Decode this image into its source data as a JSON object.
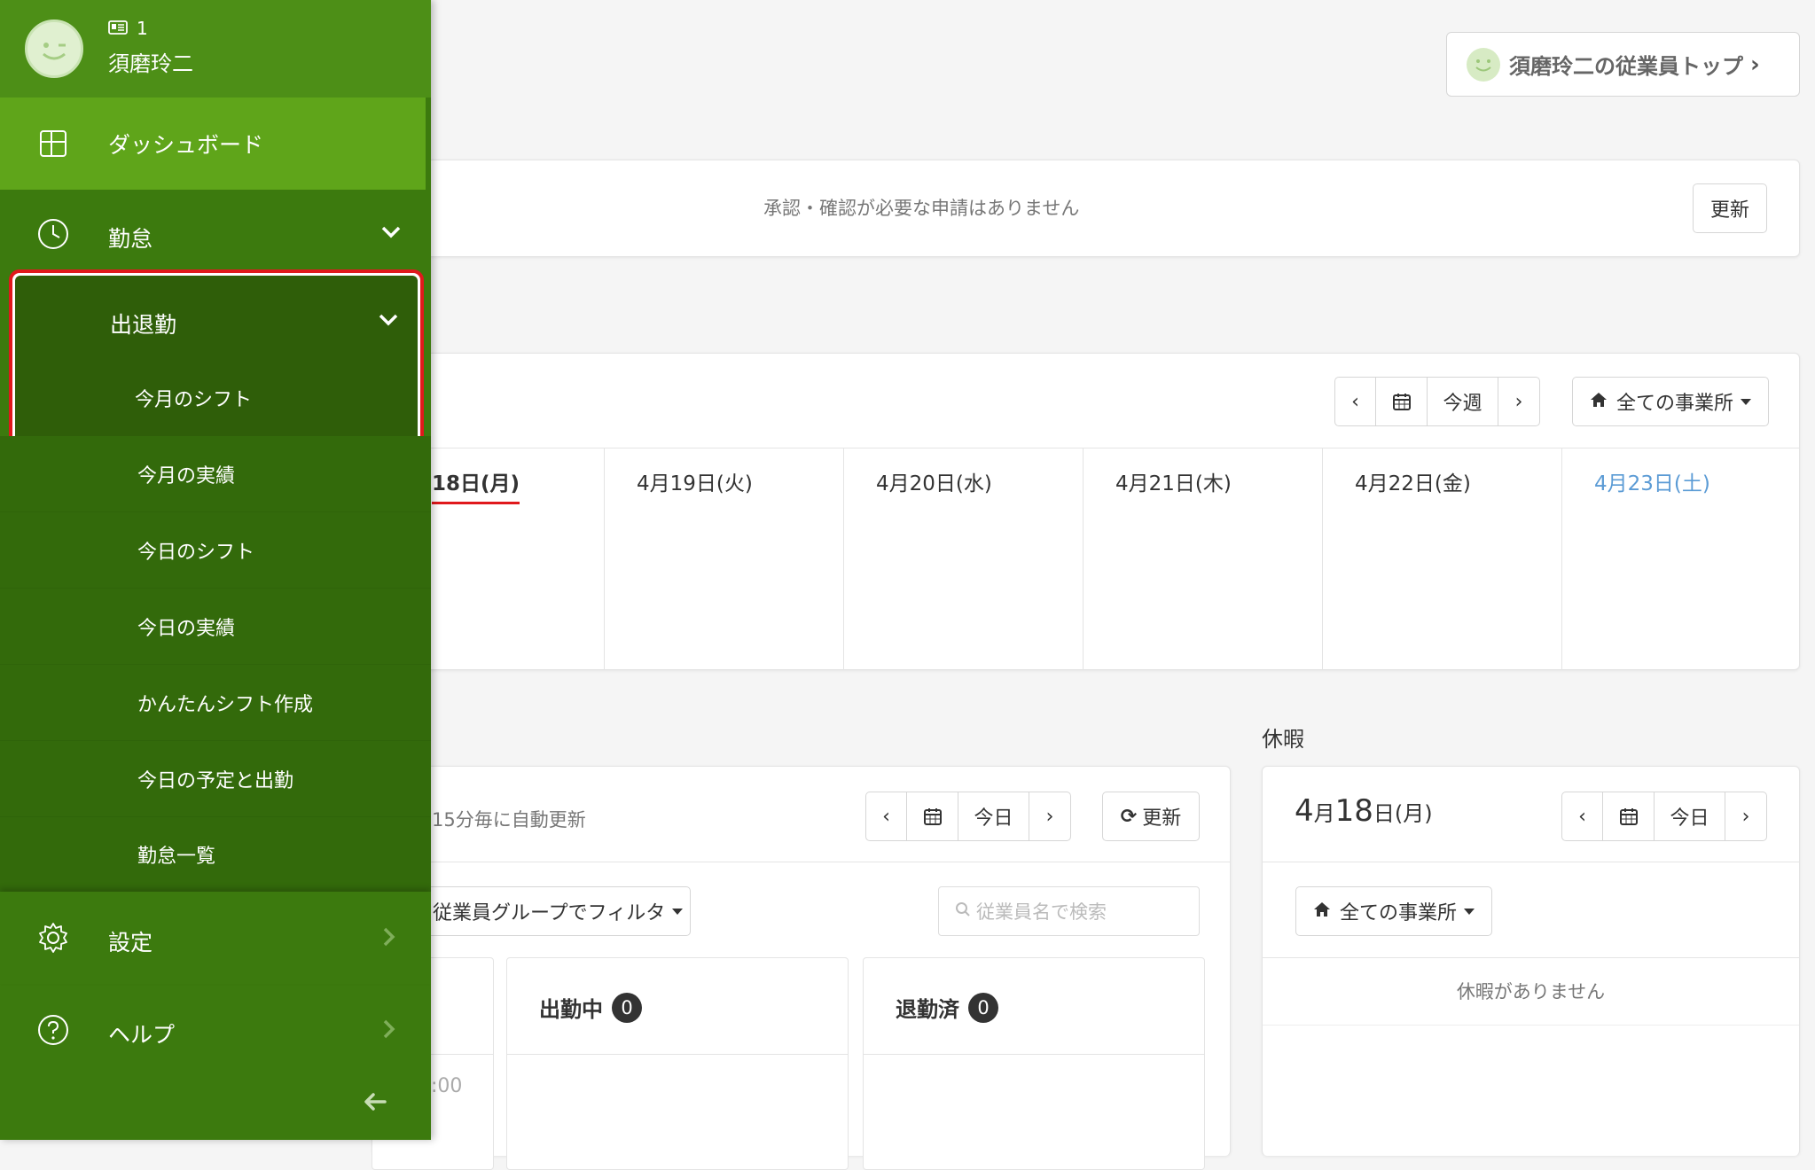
{
  "header": {
    "top_button_label": "須磨玲二の従業員トップ"
  },
  "approval": {
    "message": "承認・確認が必要な申請はありません",
    "refresh_label": "更新"
  },
  "week_calendar": {
    "today_label": "今週",
    "office_filter": "全ての事業所",
    "days": [
      {
        "label": "18日(月)",
        "is_today": true
      },
      {
        "label": "4月19日(火)"
      },
      {
        "label": "4月20日(水)"
      },
      {
        "label": "4月21日(木)"
      },
      {
        "label": "4月22日(金)"
      },
      {
        "label": "4月23日(土)",
        "is_saturday": true
      }
    ]
  },
  "attendance": {
    "auto_refresh_text": "15分毎に自動更新",
    "today_label": "今日",
    "refresh_label": "更新",
    "group_filter": "従業員グループでフィルタ",
    "search_placeholder": "従業員名で検索",
    "working_label": "出勤中",
    "working_count": "0",
    "left_label": "退勤済",
    "left_count": "0",
    "partial_time": ":00"
  },
  "leave": {
    "section_title": "休暇",
    "date_month": "4",
    "date_month_unit": "月",
    "date_day": "18",
    "date_day_unit": "日(月)",
    "today_label": "今日",
    "office_filter": "全ての事業所",
    "empty_message": "休暇がありません"
  },
  "sidebar": {
    "user_id": "1",
    "user_name": "須磨玲二",
    "dashboard_label": "ダッシュボード",
    "kintai_label": "勤怠",
    "shuttaikin_label": "出退勤",
    "sub_items": [
      "今月のシフト",
      "今月の実績",
      "今日のシフト",
      "今日の実績",
      "かんたんシフト作成",
      "今日の予定と出勤",
      "勤怠一覧"
    ],
    "settings_label": "設定",
    "help_label": "ヘルプ"
  },
  "colors": {
    "sidebar_bg": "#3c7a0e",
    "sidebar_active": "#5fa51a",
    "highlight_border": "#e0191c",
    "saturday_blue": "#5b9bd5",
    "today_underline": "#e0191c"
  }
}
